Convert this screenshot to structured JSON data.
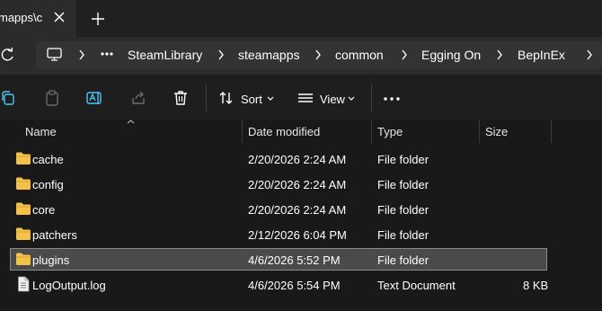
{
  "tab": {
    "title": "mapps\\c"
  },
  "breadcrumb": {
    "items": [
      "SteamLibrary",
      "steamapps",
      "common",
      "Egging On",
      "BepInEx"
    ]
  },
  "toolbar": {
    "sort_label": "Sort",
    "view_label": "View"
  },
  "columns": {
    "name": "Name",
    "date": "Date modified",
    "type": "Type",
    "size": "Size"
  },
  "files": [
    {
      "name": "cache",
      "date": "2/20/2026 2:24 AM",
      "type": "File folder",
      "size": "",
      "icon": "folder-icon"
    },
    {
      "name": "config",
      "date": "2/20/2026 2:24 AM",
      "type": "File folder",
      "size": "",
      "icon": "folder-icon"
    },
    {
      "name": "core",
      "date": "2/20/2026 2:24 AM",
      "type": "File folder",
      "size": "",
      "icon": "folder-icon"
    },
    {
      "name": "patchers",
      "date": "2/12/2026 6:04 PM",
      "type": "File folder",
      "size": "",
      "icon": "folder-icon"
    },
    {
      "name": "plugins",
      "date": "4/6/2026 5:52 PM",
      "type": "File folder",
      "size": "",
      "icon": "folder-icon",
      "selected": true
    },
    {
      "name": "LogOutput.log",
      "date": "4/6/2026 5:54 PM",
      "type": "Text Document",
      "size": "8 KB",
      "icon": "document-icon"
    }
  ],
  "colors": {
    "folder": "#f4c14b",
    "background": "#191919",
    "selection": "#4a4a4a"
  }
}
